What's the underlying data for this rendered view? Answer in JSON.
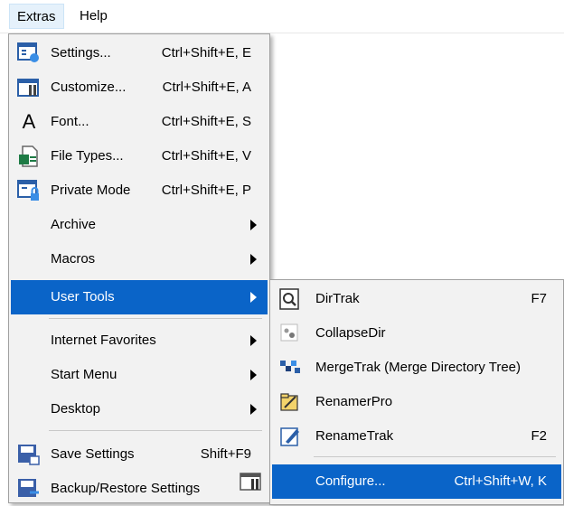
{
  "menubar": {
    "extras": "Extras",
    "help": "Help"
  },
  "extras_menu": {
    "items": [
      {
        "label": "Settings...",
        "shortcut": "Ctrl+Shift+E, E",
        "icon": "settings-icon"
      },
      {
        "label": "Customize...",
        "shortcut": "Ctrl+Shift+E, A",
        "icon": "customize-icon"
      },
      {
        "label": "Font...",
        "shortcut": "Ctrl+Shift+E, S",
        "icon": "font-icon"
      },
      {
        "label": "File Types...",
        "shortcut": "Ctrl+Shift+E, V",
        "icon": "file-types-icon"
      },
      {
        "label": "Private Mode",
        "shortcut": "Ctrl+Shift+E, P",
        "icon": "private-mode-icon"
      },
      {
        "label": "Archive",
        "submenu": true
      },
      {
        "label": "Macros",
        "submenu": true
      },
      {
        "label": "User Tools",
        "submenu": true,
        "highlighted": true
      },
      {
        "label": "Internet Favorites",
        "submenu": true
      },
      {
        "label": "Start Menu",
        "submenu": true
      },
      {
        "label": "Desktop",
        "submenu": true
      },
      {
        "label": "Save Settings",
        "shortcut": "Shift+F9",
        "icon": "save-settings-icon"
      },
      {
        "label": "Backup/Restore Settings",
        "icon": "backup-restore-icon"
      }
    ]
  },
  "user_tools_menu": {
    "items": [
      {
        "label": "DirTrak",
        "shortcut": "F7",
        "icon": "dirtrak-icon"
      },
      {
        "label": "CollapseDir",
        "icon": "collapsedir-icon"
      },
      {
        "label": "MergeTrak (Merge Directory Tree)",
        "icon": "mergetrak-icon"
      },
      {
        "label": "RenamerPro",
        "icon": "renamerpro-icon"
      },
      {
        "label": "RenameTrak",
        "shortcut": "F2",
        "icon": "renametrak-icon"
      },
      {
        "label": "Configure...",
        "shortcut": "Ctrl+Shift+W, K",
        "icon": "configure-icon",
        "highlighted": true
      }
    ]
  },
  "colors": {
    "highlight": "#0a64c8",
    "menu_bg": "#f2f2f2"
  }
}
